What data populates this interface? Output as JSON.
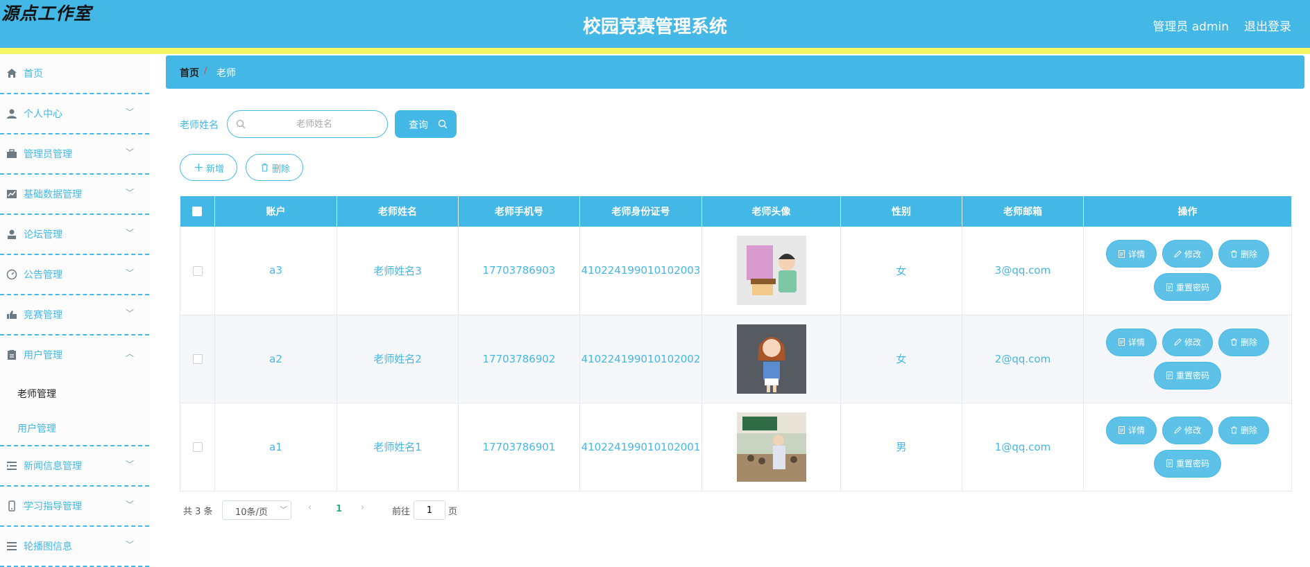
{
  "header": {
    "logo": "源点工作室",
    "title": "校园竞赛管理系统",
    "user": "管理员 admin",
    "logout": "退出登录"
  },
  "sidebar": {
    "items": [
      {
        "label": "首页",
        "icon": "home-icon"
      },
      {
        "label": "个人中心",
        "icon": "person-icon"
      },
      {
        "label": "管理员管理",
        "icon": "briefcase-icon"
      },
      {
        "label": "基础数据管理",
        "icon": "chart-icon"
      },
      {
        "label": "论坛管理",
        "icon": "user-icon"
      },
      {
        "label": "公告管理",
        "icon": "gauge-icon"
      },
      {
        "label": "竞赛管理",
        "icon": "thumb-icon"
      },
      {
        "label": "用户管理",
        "icon": "clipboard-icon"
      },
      {
        "label": "新闻信息管理",
        "icon": "list-icon"
      },
      {
        "label": "学习指导管理",
        "icon": "phone-icon"
      },
      {
        "label": "轮播图信息",
        "icon": "menu-icon"
      }
    ],
    "sub_items": [
      {
        "label": "老师管理"
      },
      {
        "label": "用户管理"
      }
    ]
  },
  "breadcrumb": {
    "home": "首页",
    "separator": "/",
    "current": "老师"
  },
  "search": {
    "label": "老师姓名",
    "placeholder": "老师姓名",
    "button": "查询"
  },
  "toolbar": {
    "add": "新增",
    "delete": "删除"
  },
  "table": {
    "headers": [
      "账户",
      "老师姓名",
      "老师手机号",
      "老师身份证号",
      "老师头像",
      "性别",
      "老师邮箱",
      "操作"
    ],
    "rows": [
      {
        "account": "a3",
        "name": "老师姓名3",
        "phone": "17703786903",
        "id_number": "410224199010102003",
        "gender": "女",
        "email": "3@qq.com"
      },
      {
        "account": "a2",
        "name": "老师姓名2",
        "phone": "17703786902",
        "id_number": "410224199010102002",
        "gender": "女",
        "email": "2@qq.com"
      },
      {
        "account": "a1",
        "name": "老师姓名1",
        "phone": "17703786901",
        "id_number": "410224199010102001",
        "gender": "男",
        "email": "1@qq.com"
      }
    ],
    "actions": {
      "detail": "详情",
      "edit": "修改",
      "delete": "删除",
      "reset_password": "重置密码"
    }
  },
  "pagination": {
    "total": "共 3 条",
    "page_size": "10条/页",
    "current_page": "1",
    "goto_label": "前往",
    "goto_value": "1",
    "goto_unit": "页"
  },
  "colors": {
    "primary": "#43b8e6",
    "strip": "#f5f566"
  }
}
